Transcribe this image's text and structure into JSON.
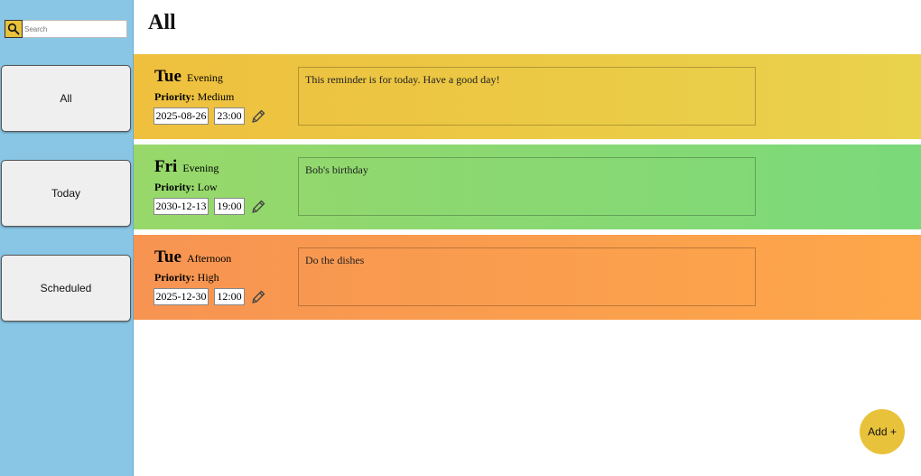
{
  "sidebar": {
    "search_placeholder": "Search",
    "items": [
      {
        "label": "All"
      },
      {
        "label": "Today"
      },
      {
        "label": "Scheduled"
      }
    ]
  },
  "main": {
    "title": "All",
    "add_label": "Add +"
  },
  "reminders": [
    {
      "day": "Tue",
      "time_of_day": "Evening",
      "priority_label": "Priority:",
      "priority": "Medium",
      "date": "2025-08-26",
      "time": "23:00",
      "note": "This reminder is for today. Have a good day!",
      "color": "#eec03e"
    },
    {
      "day": "Fri",
      "time_of_day": "Evening",
      "priority_label": "Priority:",
      "priority": "Low",
      "date": "2030-12-13",
      "time": "19:00",
      "note": "Bob's birthday",
      "color": "#8fd86e"
    },
    {
      "day": "Tue",
      "time_of_day": "Afternoon",
      "priority_label": "Priority:",
      "priority": "High",
      "date": "2025-12-30",
      "time": "12:00",
      "note": "Do the dishes",
      "color": "#fa9c4e"
    }
  ],
  "icons": {
    "search": "search-icon",
    "edit": "pencil-icon"
  }
}
